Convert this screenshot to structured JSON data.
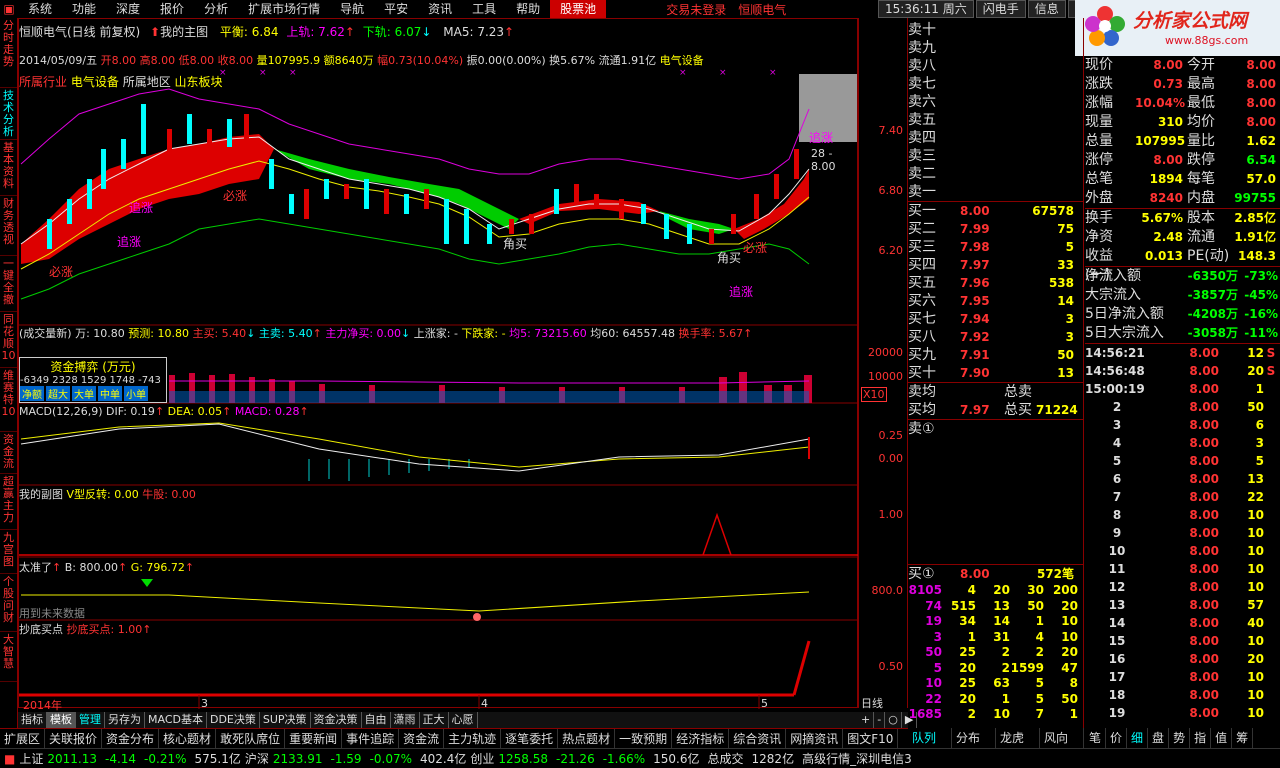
{
  "menu": {
    "items": [
      "系统",
      "功能",
      "深度",
      "报价",
      "分析",
      "扩展市场行情",
      "导航",
      "平安",
      "资讯",
      "工具",
      "帮助"
    ],
    "active": "股票池",
    "login": "交易未登录",
    "broker": "恒顺电气",
    "time": "15:36:11",
    "weekday": "周六",
    "btn1": "闪电手",
    "btn2": "信息",
    "btn3": "行情"
  },
  "brand": {
    "name": "分析家公式网",
    "url": "www.88gs.com"
  },
  "sidebar": [
    "分时走势",
    "技术分析",
    "基本资料",
    "财务透视",
    "一键全撤",
    "同花顺10",
    "维赛特10",
    "资金流",
    "超赢主力",
    "九宫图",
    "个股问财",
    "大智慧"
  ],
  "main_header": {
    "title": "恒顺电气(日线 前复权)",
    "chart_name": "我的主图",
    "balance": "平衡: 6.84",
    "upper": "上轨: 7.62",
    "lower": "下轨: 6.07",
    "ma5": "MA5: 7.23"
  },
  "info_line": {
    "date": "2014/05/09/五",
    "open": "开8.00",
    "high": "高8.00",
    "low": "低8.00",
    "close": "收8.00",
    "vol": "量107995.9",
    "amount": "额8640万",
    "change": "幅0.73(10.04%)",
    "amp": "振0.00(0.00%)",
    "turnover": "换5.67%",
    "float": "流通1.91亿",
    "sector": "电气设备"
  },
  "industry_line": {
    "industry": "所属行业",
    "industry_val": "电气设备",
    "region": "所属地区",
    "region_val": "山东板块"
  },
  "price_ticks": [
    "7.40",
    "6.80",
    "6.20"
  ],
  "price_label": "28 - 8.00",
  "annotations": {
    "zhuizhang": "追涨",
    "bizhang": "必涨",
    "jiaomai": "角买"
  },
  "vol_header": {
    "name": "(成交量新) 万: 10.80",
    "pred": "预测: 10.80",
    "buy": "主买: 5.40",
    "sell": "主卖: 5.40",
    "net": "主力净买: 0.00",
    "up": "上涨家: -",
    "down": "下跌家: -",
    "avg5": "均5: 73215.60",
    "avg60": "均60: 64557.48",
    "turnover": "换手率: 5.67"
  },
  "vol_ticks": [
    "20000",
    "10000",
    "X10"
  ],
  "fund_box": {
    "title": "资金搏弈 (万元)",
    "values": "-6349 2328 1529 1748 -743",
    "labels": [
      "净额",
      "超大",
      "大单",
      "中单",
      "小单"
    ]
  },
  "macd_header": {
    "name": "MACD(12,26,9)",
    "dif": "DIF: 0.19",
    "dea": "DEA: 0.05",
    "macd": "MACD: 0.28"
  },
  "macd_ticks": [
    "0.25",
    "0.00"
  ],
  "sub1_header": {
    "name": "我的副图",
    "v": "V型反转: 0.00",
    "niu": "牛股: 0.00"
  },
  "sub1_ticks": [
    "1.00"
  ],
  "sub2_header": {
    "name": "太准了",
    "b": "B: 800.00",
    "g": "G: 796.72",
    "future": "用到未来数据"
  },
  "sub2_ticks": [
    "800.0"
  ],
  "sub3_header": {
    "name": "抄底买点",
    "val": "抄底买点: 1.00"
  },
  "sub3_ticks": [
    "0.50"
  ],
  "x_axis": [
    "2014年",
    "3",
    "4",
    "5"
  ],
  "axis_label": "日线",
  "tabs": [
    "指标",
    "模板",
    "管理",
    "另存为",
    "MACD基本",
    "DDE决策",
    "SUP决策",
    "资金决策",
    "自由",
    "潇雨",
    "正大",
    "心愿"
  ],
  "tabs_selected": "模板",
  "zoom_buttons": [
    "+",
    "-",
    "○",
    "▶"
  ],
  "bottom_buttons": [
    "扩展区",
    "关联报价",
    "资金分布",
    "核心题材",
    "敢死队席位",
    "重要新闻",
    "事件追踪",
    "资金流",
    "主力轨迹",
    "逐笔委托",
    "热点题材",
    "一致预期",
    "经济指标",
    "综合资讯",
    "网摘资讯",
    "图文F10"
  ],
  "right_tabs": [
    "队列",
    "分布",
    "龙虎",
    "风向"
  ],
  "far_right_tabs": [
    "笔",
    "价",
    "细",
    "盘",
    "势",
    "指",
    "值",
    "筹"
  ],
  "orderbook": {
    "sell": [
      {
        "label": "卖十",
        "price": "",
        "vol": ""
      },
      {
        "label": "卖九",
        "price": "",
        "vol": ""
      },
      {
        "label": "卖八",
        "price": "",
        "vol": ""
      },
      {
        "label": "卖七",
        "price": "",
        "vol": ""
      },
      {
        "label": "卖六",
        "price": "",
        "vol": ""
      },
      {
        "label": "卖五",
        "price": "",
        "vol": ""
      },
      {
        "label": "卖四",
        "price": "",
        "vol": ""
      },
      {
        "label": "卖三",
        "price": "",
        "vol": ""
      },
      {
        "label": "卖二",
        "price": "",
        "vol": ""
      },
      {
        "label": "卖一",
        "price": "",
        "vol": ""
      }
    ],
    "buy": [
      {
        "label": "买一",
        "price": "8.00",
        "vol": "67578"
      },
      {
        "label": "买二",
        "price": "7.99",
        "vol": "75"
      },
      {
        "label": "买三",
        "price": "7.98",
        "vol": "5"
      },
      {
        "label": "买四",
        "price": "7.97",
        "vol": "33"
      },
      {
        "label": "买五",
        "price": "7.96",
        "vol": "538"
      },
      {
        "label": "买六",
        "price": "7.95",
        "vol": "14"
      },
      {
        "label": "买七",
        "price": "7.94",
        "vol": "3"
      },
      {
        "label": "买八",
        "price": "7.92",
        "vol": "3"
      },
      {
        "label": "买九",
        "price": "7.91",
        "vol": "50"
      },
      {
        "label": "买十",
        "price": "7.90",
        "vol": "13"
      }
    ],
    "sell_avg_label": "卖均",
    "sell_total_label": "总卖",
    "buy_avg_label": "买均",
    "buy_avg": "7.97",
    "buy_total_label": "总买",
    "buy_total": "71224",
    "sell1_queue": "卖①",
    "buy1_queue": "买①",
    "buy1_price": "8.00",
    "buy1_count": "572笔",
    "queue": [
      [
        "8105",
        "4",
        "20",
        "30",
        "200"
      ],
      [
        "74",
        "515",
        "13",
        "50",
        "20"
      ],
      [
        "19",
        "34",
        "14",
        "1",
        "10"
      ],
      [
        "3",
        "1",
        "31",
        "4",
        "10"
      ],
      [
        "50",
        "25",
        "2",
        "2",
        "20"
      ],
      [
        "5",
        "20",
        "2",
        "1599",
        "47"
      ],
      [
        "10",
        "25",
        "63",
        "5",
        "8"
      ],
      [
        "22",
        "20",
        "1",
        "5",
        "50"
      ],
      [
        "1685",
        "2",
        "10",
        "7",
        "1"
      ]
    ]
  },
  "quote": {
    "rows": [
      [
        "现价",
        "8.00",
        "今开",
        "8.00"
      ],
      [
        "涨跌",
        "0.73",
        "最高",
        "8.00"
      ],
      [
        "涨幅",
        "10.04%",
        "最低",
        "8.00"
      ],
      [
        "现量",
        "310",
        "均价",
        "8.00"
      ],
      [
        "总量",
        "107995",
        "量比",
        "1.62"
      ],
      [
        "涨停",
        "8.00",
        "跌停",
        "6.54"
      ],
      [
        "总笔",
        "1894",
        "每笔",
        "57.0"
      ],
      [
        "外盘",
        "8240",
        "内盘",
        "99755"
      ]
    ],
    "rows2": [
      [
        "换手",
        "5.67%",
        "股本",
        "2.85亿"
      ],
      [
        "净资",
        "2.48",
        "流通",
        "1.91亿"
      ],
      [
        "收益(一)",
        "0.013",
        "PE(动)",
        "148.3"
      ]
    ],
    "flows": [
      [
        "净流入额",
        "-6350万",
        "-73%"
      ],
      [
        "大宗流入",
        "-3857万",
        "-45%"
      ],
      [
        "5日净流入额",
        "-4208万",
        "-16%"
      ],
      [
        "5日大宗流入",
        "-3058万",
        "-11%"
      ]
    ],
    "ticks": [
      [
        "14:56:21",
        "8.00",
        "12",
        "S"
      ],
      [
        "14:56:48",
        "8.00",
        "20",
        "S"
      ],
      [
        "15:00:19",
        "8.00",
        "1",
        ""
      ],
      [
        "2",
        "8.00",
        "50",
        ""
      ],
      [
        "3",
        "8.00",
        "6",
        ""
      ],
      [
        "4",
        "8.00",
        "3",
        ""
      ],
      [
        "5",
        "8.00",
        "5",
        ""
      ],
      [
        "6",
        "8.00",
        "13",
        ""
      ],
      [
        "7",
        "8.00",
        "22",
        ""
      ],
      [
        "8",
        "8.00",
        "10",
        ""
      ],
      [
        "9",
        "8.00",
        "10",
        ""
      ],
      [
        "10",
        "8.00",
        "10",
        ""
      ],
      [
        "11",
        "8.00",
        "10",
        ""
      ],
      [
        "12",
        "8.00",
        "10",
        ""
      ],
      [
        "13",
        "8.00",
        "57",
        ""
      ],
      [
        "14",
        "8.00",
        "40",
        ""
      ],
      [
        "15",
        "8.00",
        "10",
        ""
      ],
      [
        "16",
        "8.00",
        "20",
        ""
      ],
      [
        "17",
        "8.00",
        "10",
        ""
      ],
      [
        "18",
        "8.00",
        "10",
        ""
      ],
      [
        "19",
        "8.00",
        "10",
        ""
      ]
    ]
  },
  "status": {
    "sh_label": "上证",
    "sh": "2011.13",
    "sh_chg": "-4.14",
    "sh_pct": "-0.21%",
    "sh_amt": "575.1亿",
    "sz_label": "沪深",
    "sz": "2133.91",
    "sz_chg": "-1.59",
    "sz_pct": "-0.07%",
    "sz_amt": "402.4亿",
    "cy_label": "创业",
    "cy": "1258.58",
    "cy_chg": "-21.26",
    "cy_pct": "-1.66%",
    "cy_amt": "150.6亿",
    "total_label": "总成交",
    "total": "1282亿",
    "server": "高级行情_深圳电信3"
  }
}
